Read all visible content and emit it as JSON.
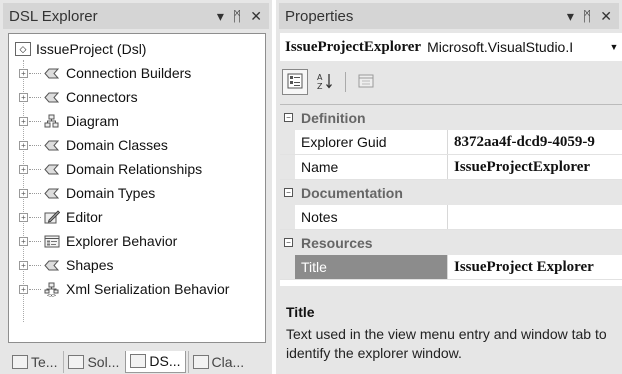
{
  "explorer": {
    "title": "DSL Explorer",
    "buttons": {
      "dropdown": "▾",
      "pin": "ᛗ",
      "close": "✕"
    },
    "root": {
      "label": "IssueProject (Dsl)"
    },
    "items": [
      {
        "label": "Connection Builders",
        "icon": "shape-icon"
      },
      {
        "label": "Connectors",
        "icon": "shape-icon"
      },
      {
        "label": "Diagram",
        "icon": "diagram-icon"
      },
      {
        "label": "Domain Classes",
        "icon": "shape-icon"
      },
      {
        "label": "Domain Relationships",
        "icon": "shape-icon"
      },
      {
        "label": "Domain Types",
        "icon": "shape-icon"
      },
      {
        "label": "Editor",
        "icon": "editor-icon"
      },
      {
        "label": "Explorer Behavior",
        "icon": "explorer-icon"
      },
      {
        "label": "Shapes",
        "icon": "shape-icon"
      },
      {
        "label": "Xml Serialization Behavior",
        "icon": "xml-icon"
      }
    ],
    "tabs": [
      {
        "label": "Te..."
      },
      {
        "label": "Sol..."
      },
      {
        "label": "DS..."
      },
      {
        "label": "Cla..."
      }
    ]
  },
  "properties": {
    "title": "Properties",
    "buttons": {
      "dropdown": "▾",
      "pin": "ᛗ",
      "close": "✕"
    },
    "object": {
      "name": "IssueProjectExplorer",
      "type": "Microsoft.VisualStudio.I"
    },
    "toolbar": {
      "categorized": "▦",
      "alphabetical": "A↓Z",
      "pages": "▭"
    },
    "categories": [
      {
        "name": "Definition",
        "rows": [
          {
            "name": "Explorer Guid",
            "value": "8372aa4f-dcd9-4059-9"
          },
          {
            "name": "Name",
            "value": "IssueProjectExplorer"
          }
        ]
      },
      {
        "name": "Documentation",
        "rows": [
          {
            "name": "Notes",
            "value": ""
          }
        ]
      },
      {
        "name": "Resources",
        "rows": [
          {
            "name": "Title",
            "value": "IssueProject Explorer"
          }
        ]
      }
    ],
    "description": {
      "title": "Title",
      "text": "Text used in the view menu entry and window tab to identify the explorer window."
    }
  }
}
